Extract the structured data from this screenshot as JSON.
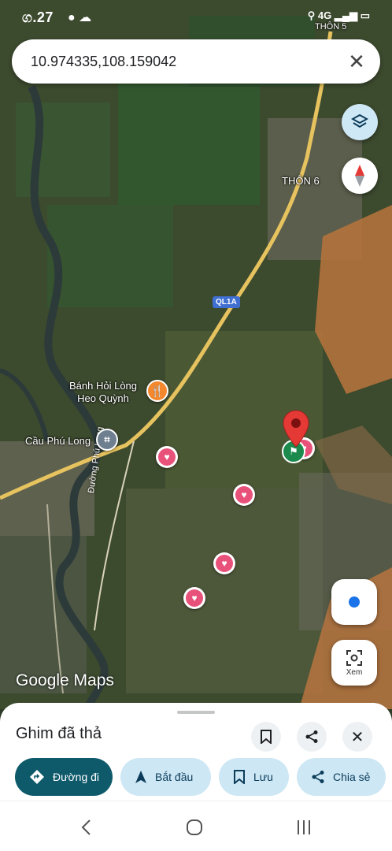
{
  "status_bar": {
    "time": "ග.27",
    "network": "4G",
    "area_label": "THÔN 5"
  },
  "search": {
    "query": "10.974335,108.159042"
  },
  "map": {
    "labels": {
      "thon6": "THÔN 6",
      "highway": "QL1A",
      "road": "Đường Phú Long",
      "bridge": "Cầu Phú Long",
      "restaurant_line1": "Bánh Hỏi Lòng",
      "restaurant_line2": "Heo Quỳnh"
    },
    "logo": "Google Maps",
    "view_button_label": "Xem",
    "colors": {
      "pin_red": "#e53935",
      "heart": "#e8527a",
      "food": "#f3882f",
      "road": "#e7c35f"
    }
  },
  "sheet": {
    "title": "Ghim đã thả",
    "actions": {
      "directions": "Đường đi",
      "start": "Bắt đầu",
      "save": "Lưu",
      "share": "Chia sẻ"
    }
  }
}
